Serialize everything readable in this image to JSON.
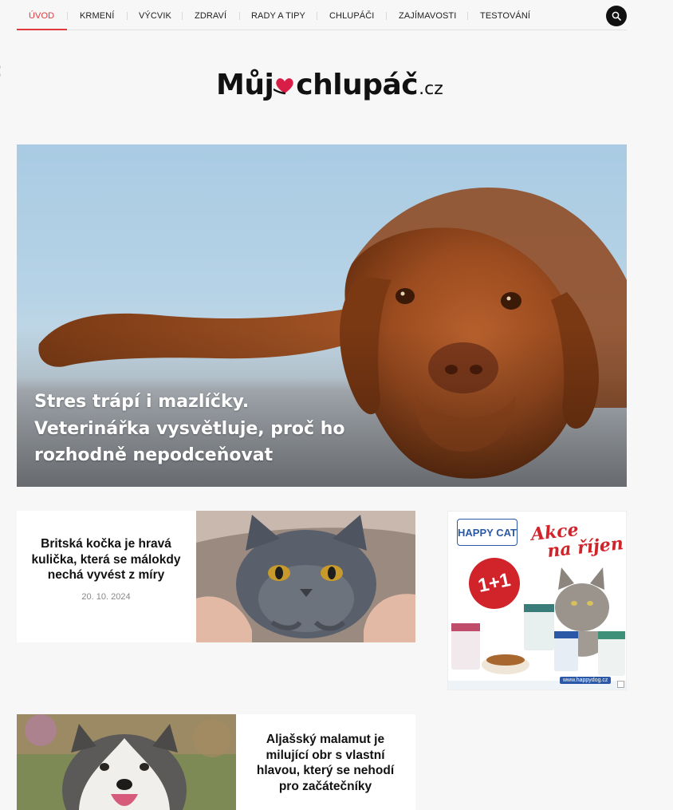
{
  "nav": {
    "items": [
      {
        "label": "ÚVOD",
        "active": true
      },
      {
        "label": "KRMENÍ",
        "active": false
      },
      {
        "label": "VÝCVIK",
        "active": false
      },
      {
        "label": "ZDRAVÍ",
        "active": false
      },
      {
        "label": "RADY A TIPY",
        "active": false
      },
      {
        "label": "CHLUPÁČI",
        "active": false
      },
      {
        "label": "ZAJÍMAVOSTI",
        "active": false
      },
      {
        "label": "TESTOVÁNÍ",
        "active": false
      }
    ],
    "search_icon": "search-icon",
    "accent_color": "#e0393e"
  },
  "logo": {
    "text_left": "Můj",
    "text_right": "chlupáč",
    "suffix": ".cz",
    "heart_color": "#d81e47"
  },
  "hero": {
    "title": "Stres trápí i mazlíčky. Veterinářka vysvětluje, proč ho rozhodně nepodceňovat"
  },
  "articles": [
    {
      "title": "Britská kočka je hravá kulička, která se málokdy nechá vyvést z míry",
      "date": "20. 10. 2024"
    },
    {
      "title": "Aljašský malamut je milující obr s vlastní hlavou, který se nehodí pro začátečníky"
    }
  ],
  "ad": {
    "brand": "HAPPY CAT",
    "promo_line1": "Akce",
    "promo_line2": "na říjen",
    "badge": "1+1",
    "url": "www.happydog.cz",
    "brand_color": "#2a58a6",
    "promo_color": "#d1232a"
  }
}
